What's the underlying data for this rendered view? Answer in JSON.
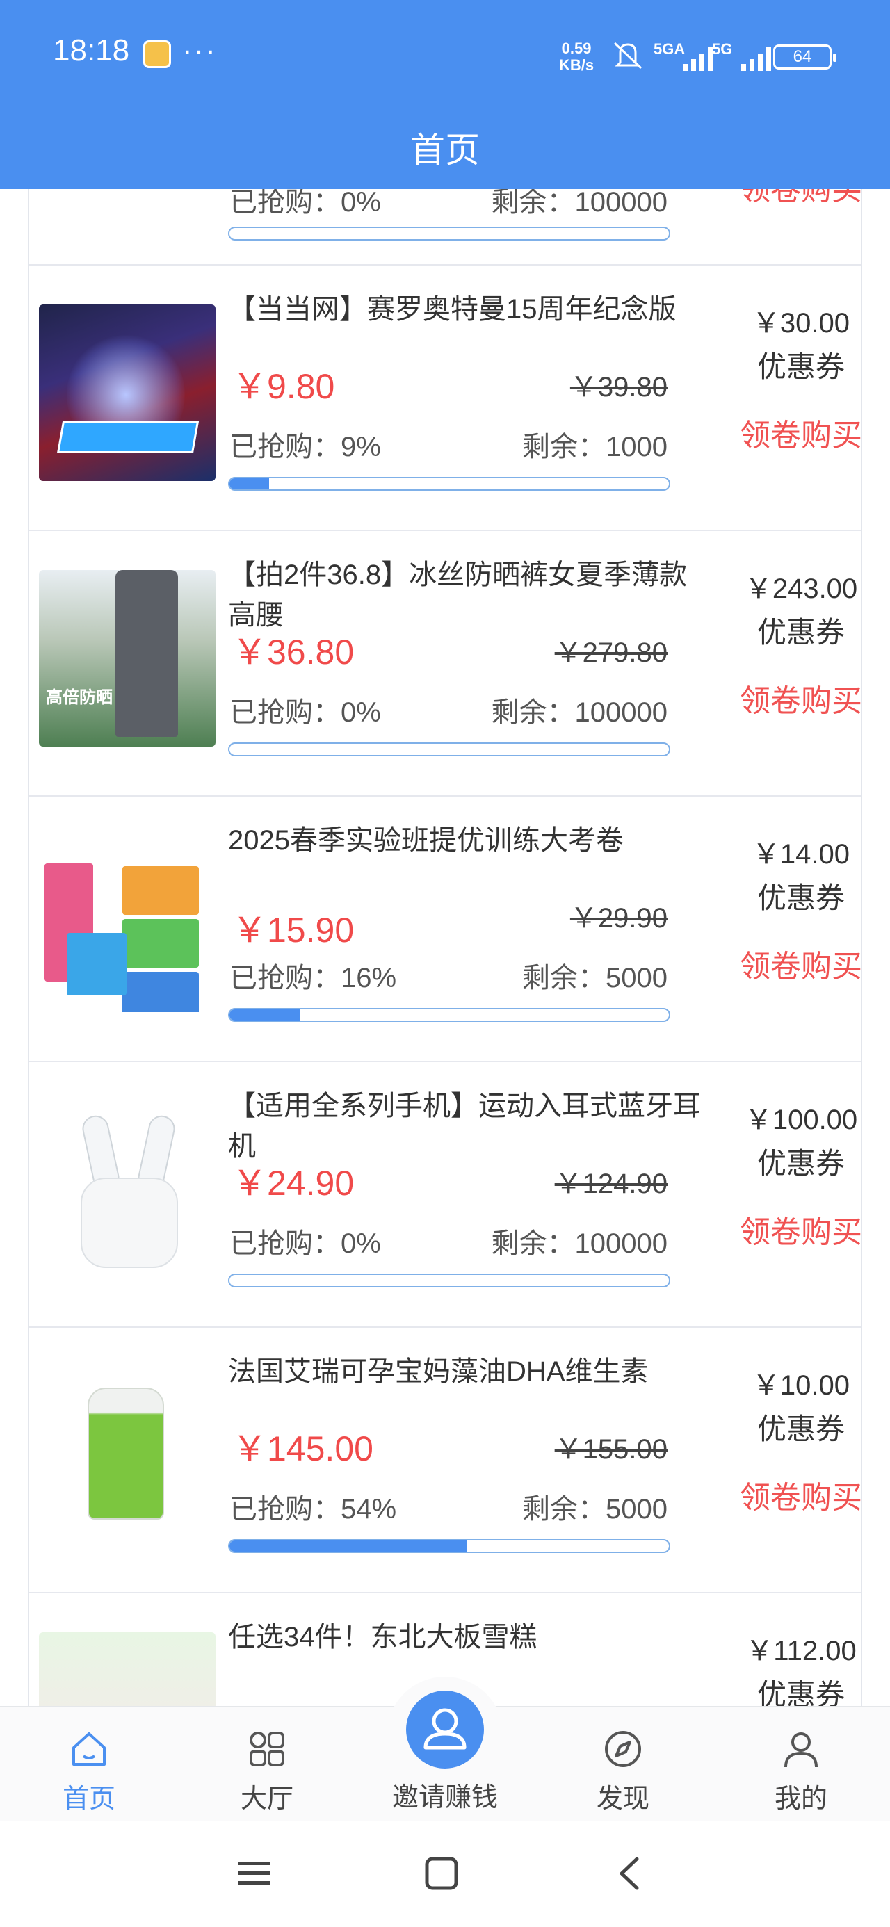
{
  "status_bar": {
    "time": "18:18",
    "dots": "···",
    "speed_value": "0.59",
    "speed_unit": "KB/s",
    "signal1": "5GA",
    "signal2": "5G",
    "battery": "64"
  },
  "header": {
    "title": "首页"
  },
  "products": [
    {
      "title": "",
      "price": "",
      "orig_price": "",
      "sold_label": "已抢购：0%",
      "remain_label": "剩余：100000",
      "progress": 0,
      "coupon_value": "",
      "coupon_label": "",
      "buy_label": "领卷购买"
    },
    {
      "title": "【当当网】赛罗奥特曼15周年纪念版",
      "price": "￥9.80",
      "orig_price": "￥39.80",
      "sold_label": "已抢购：9%",
      "remain_label": "剩余：1000",
      "progress": 0.09,
      "coupon_value": "￥30.00",
      "coupon_label": "优惠券",
      "buy_label": "领卷购买"
    },
    {
      "title": "【拍2件36.8】冰丝防晒裤女夏季薄款高腰",
      "price": "￥36.80",
      "orig_price": "￥279.80",
      "sold_label": "已抢购：0%",
      "remain_label": "剩余：100000",
      "progress": 0,
      "coupon_value": "￥243.00",
      "coupon_label": "优惠券",
      "buy_label": "领卷购买",
      "image_caption": "高倍防晒"
    },
    {
      "title": "2025春季实验班提优训练大考卷",
      "price": "￥15.90",
      "orig_price": "￥29.90",
      "sold_label": "已抢购：16%",
      "remain_label": "剩余：5000",
      "progress": 0.16,
      "coupon_value": "￥14.00",
      "coupon_label": "优惠券",
      "buy_label": "领卷购买"
    },
    {
      "title": "【适用全系列手机】运动入耳式蓝牙耳机",
      "price": "￥24.90",
      "orig_price": "￥124.90",
      "sold_label": "已抢购：0%",
      "remain_label": "剩余：100000",
      "progress": 0,
      "coupon_value": "￥100.00",
      "coupon_label": "优惠券",
      "buy_label": "领卷购买"
    },
    {
      "title": "法国艾瑞可孕宝妈藻油DHA维生素",
      "price": "￥145.00",
      "orig_price": "￥155.00",
      "sold_label": "已抢购：54%",
      "remain_label": "剩余：5000",
      "progress": 0.54,
      "coupon_value": "￥10.00",
      "coupon_label": "优惠券",
      "buy_label": "领卷购买"
    },
    {
      "title": "任选34件！东北大板雪糕",
      "price": "",
      "orig_price": "",
      "sold_label": "",
      "remain_label": "",
      "progress": 0,
      "coupon_value": "￥112.00",
      "coupon_label": "优惠券",
      "buy_label": ""
    }
  ],
  "bottom_nav": {
    "home": "首页",
    "hall": "大厅",
    "invite": "邀请赚钱",
    "discover": "发现",
    "mine": "我的"
  },
  "colors": {
    "primary": "#4a8ff0",
    "price_red": "#f04a4a"
  }
}
